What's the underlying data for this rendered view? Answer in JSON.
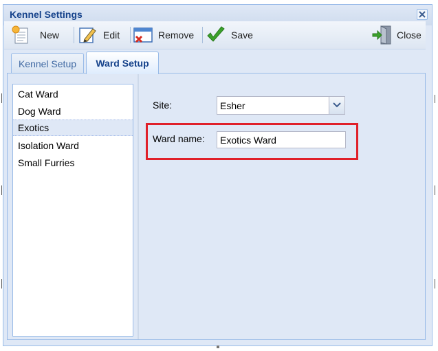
{
  "window": {
    "title": "Kennel Settings"
  },
  "toolbar": {
    "new_label": "New",
    "edit_label": "Edit",
    "remove_label": "Remove",
    "save_label": "Save",
    "close_label": "Close"
  },
  "tabs": [
    {
      "label": "Kennel Setup",
      "active": false
    },
    {
      "label": "Ward Setup",
      "active": true
    }
  ],
  "wards": [
    {
      "label": "Cat Ward",
      "selected": false
    },
    {
      "label": "Dog Ward",
      "selected": false
    },
    {
      "label": "Exotics",
      "selected": true
    },
    {
      "label": "Isolation Ward",
      "selected": false
    },
    {
      "label": "Small Furries",
      "selected": false
    }
  ],
  "form": {
    "site_label": "Site:",
    "site_value": "Esher",
    "ward_name_label": "Ward name:",
    "ward_name_value": "Exotics Ward"
  },
  "colors": {
    "accent": "#15428b",
    "panel_bg": "#dfe8f6",
    "border": "#99bbe8",
    "highlight": "#e0202a",
    "save_icon": "#3aa12a"
  },
  "icons": {
    "new": "new-document-icon",
    "edit": "edit-pencil-icon",
    "remove": "remove-window-icon",
    "save": "checkmark-icon",
    "close": "exit-door-icon",
    "window_close": "close-icon",
    "combo": "chevron-down-icon"
  }
}
